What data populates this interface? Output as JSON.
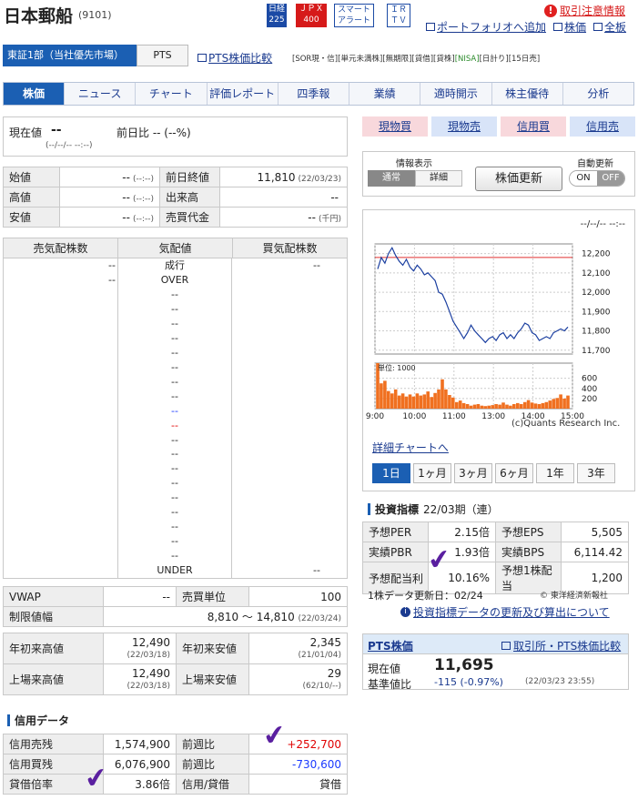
{
  "header": {
    "company_name": "日本郵船",
    "code": "(9101)",
    "badges": [
      {
        "top": "日経",
        "bottom": "225"
      },
      {
        "top": "ＪＰＸ",
        "bottom": "400"
      },
      {
        "top": "スマート",
        "bottom": "アラート"
      },
      {
        "top": "ＩＲ",
        "bottom": "ＴＶ"
      }
    ],
    "alert_link": "取引注意情報",
    "portfolio_link": "ポートフォリオへ追加",
    "stock_price_link": "株価",
    "all_board_link": "全板",
    "market_tabs": [
      "東証1部（当社優先市場）",
      "PTS"
    ],
    "pts_compare_link": "PTS株価比較",
    "tags": [
      "[SOR現・信]",
      "[単元未満株]",
      "[無期限]",
      "[貸借]",
      "[貸株]",
      "[NISA]",
      "[日計り]",
      "[15日売]"
    ]
  },
  "nav": {
    "tabs": [
      "株価",
      "ニュース",
      "チャート",
      "評価レポート",
      "四季報",
      "業績",
      "適時開示",
      "株主優待",
      "分析"
    ]
  },
  "price_box": {
    "current_label": "現在値",
    "current_value": "--",
    "change_text": "前日比 -- (--%)",
    "time_text": "(--/--/-- --:--)"
  },
  "trade_buttons": [
    "現物買",
    "現物売",
    "信用買",
    "信用売"
  ],
  "controls": {
    "info_display_label": "情報表示",
    "normal_label": "通常",
    "detail_label": "詳細",
    "update_button": "株価更新",
    "auto_update_label": "自動更新",
    "on_label": "ON",
    "off_label": "OFF"
  },
  "ohlc": [
    {
      "l1": "始値",
      "v1": "--",
      "t1": "(--:--)",
      "l2": "前日終値",
      "v2": "11,810",
      "t2": "(22/03/23)"
    },
    {
      "l1": "高値",
      "v1": "--",
      "t1": "(--:--)",
      "l2": "出来高",
      "v2": "--",
      "t2": ""
    },
    {
      "l1": "安値",
      "v1": "--",
      "t1": "(--:--)",
      "l2": "売買代金",
      "v2": "--",
      "t2": "(千円)"
    }
  ],
  "board": {
    "headers": [
      "売気配株数",
      "気配値",
      "買気配株数"
    ],
    "rows": [
      {
        "sell": "--",
        "price": "成行",
        "buy": "--"
      },
      {
        "sell": "--",
        "price": "OVER",
        "buy": ""
      },
      {
        "sell": "",
        "price": "--",
        "buy": ""
      },
      {
        "sell": "",
        "price": "--",
        "buy": ""
      },
      {
        "sell": "",
        "price": "--",
        "buy": ""
      },
      {
        "sell": "",
        "price": "--",
        "buy": ""
      },
      {
        "sell": "",
        "price": "--",
        "buy": ""
      },
      {
        "sell": "",
        "price": "--",
        "buy": ""
      },
      {
        "sell": "",
        "price": "--",
        "buy": ""
      },
      {
        "sell": "",
        "price": "--",
        "buy": ""
      },
      {
        "sell": "",
        "price": "--",
        "buy": ""
      },
      {
        "sell": "",
        "price": "--",
        "buy": ""
      },
      {
        "sell": "",
        "price": "--",
        "buy": ""
      },
      {
        "sell": "",
        "price": "--",
        "buy": ""
      },
      {
        "sell": "",
        "price": "--",
        "buy": ""
      },
      {
        "sell": "",
        "price": "--",
        "buy": ""
      },
      {
        "sell": "",
        "price": "--",
        "buy": ""
      },
      {
        "sell": "",
        "price": "--",
        "buy": ""
      },
      {
        "sell": "",
        "price": "--",
        "buy": ""
      },
      {
        "sell": "",
        "price": "--",
        "buy": ""
      },
      {
        "sell": "",
        "price": "--",
        "buy": ""
      },
      {
        "sell": "",
        "price": "UNDER",
        "buy": "--"
      }
    ],
    "blue_row": 10,
    "red_row": 11
  },
  "vwap": {
    "vwap_label": "VWAP",
    "vwap_value": "--",
    "unit_label": "売買単位",
    "unit_value": "100",
    "limit_label": "制限値幅",
    "limit_value": "8,810 〜 14,810",
    "limit_date": "(22/03/24)"
  },
  "yearly": [
    {
      "l1": "年初来高値",
      "v1": "12,490",
      "d1": "(22/03/18)",
      "l2": "年初来安値",
      "v2": "2,345",
      "d2": "(21/01/04)"
    },
    {
      "l1": "上場来高値",
      "v1": "12,490",
      "d1": "(22/03/18)",
      "l2": "上場来安値",
      "v2": "29",
      "d2": "(62/10/--)"
    }
  ],
  "credit": {
    "title": "信用データ",
    "rows": [
      {
        "l1": "信用売残",
        "v1": "1,574,900",
        "l2": "前週比",
        "v2": "+252,700",
        "c2": "red"
      },
      {
        "l1": "信用買残",
        "v1": "6,076,900",
        "l2": "前週比",
        "v2": "-730,600",
        "c2": "blue"
      },
      {
        "l1": "貸借倍率",
        "v1": "3.86倍",
        "l2": "信用/貸借",
        "v2": "貸借",
        "c2": ""
      }
    ]
  },
  "chart": {
    "timestamp": "--/--/-- --:--",
    "volume_label": "単位: 1000",
    "copyright": "(c)Quants Research Inc.",
    "detail_link": "詳細チャートへ",
    "periods": [
      "1日",
      "1ヶ月",
      "3ヶ月",
      "6ヶ月",
      "1年",
      "3年"
    ]
  },
  "chart_data": {
    "type": "line",
    "x_ticks": [
      "9:00",
      "10:00",
      "11:00",
      "13:00",
      "14:00",
      "15:00"
    ],
    "y_ticks": [
      "12,200",
      "12,100",
      "12,000",
      "11,900",
      "11,800",
      "11,700"
    ],
    "ylim": [
      11680,
      12250
    ],
    "volume_ticks": [
      "600",
      "400",
      "200"
    ],
    "volume_ylim": [
      0,
      900
    ],
    "prev_close": 11810,
    "price": [
      12120,
      12180,
      12150,
      12200,
      12230,
      12190,
      12160,
      12140,
      12170,
      12130,
      12110,
      12140,
      12120,
      12090,
      12100,
      12080,
      12060,
      12000,
      11990,
      11950,
      11900,
      11850,
      11820,
      11790,
      11760,
      11790,
      11830,
      11800,
      11780,
      11760,
      11740,
      11760,
      11770,
      11750,
      11780,
      11790,
      11760,
      11780,
      11760,
      11790,
      11810,
      11840,
      11830,
      11790,
      11780,
      11750,
      11760,
      11770,
      11760,
      11790,
      11800,
      11810,
      11800,
      11820
    ],
    "volume": [
      900,
      500,
      550,
      350,
      300,
      380,
      260,
      300,
      240,
      280,
      240,
      300,
      260,
      280,
      340,
      230,
      310,
      380,
      580,
      380,
      270,
      220,
      130,
      160,
      110,
      90,
      60,
      80,
      90,
      60,
      50,
      60,
      70,
      90,
      80,
      120,
      80,
      60,
      90,
      110,
      90,
      130,
      170,
      120,
      100,
      90,
      110,
      130,
      160,
      190,
      210,
      280,
      200,
      260
    ]
  },
  "indicators": {
    "title": "投資指標",
    "period": "22/03期（連）",
    "rows": [
      {
        "l1": "予想PER",
        "v1": "2.15倍",
        "l2": "予想EPS",
        "v2": "5,505"
      },
      {
        "l1": "実績PBR",
        "v1": "1.93倍",
        "l2": "実績BPS",
        "v2": "6,114.42"
      },
      {
        "l1": "予想配当利",
        "v1": "10.16%",
        "l2": "予想1株配当",
        "v2": "1,200"
      }
    ],
    "update_note": "1株データ更新日：02/24",
    "source": "© 東洋経済新報社",
    "notice_link": "投資指標データの更新及び算出について"
  },
  "pts": {
    "title": "PTS株価",
    "compare_link": "取引所・PTS株価比較",
    "current_label": "現在値",
    "current_value": "11,695",
    "base_label": "基準値比",
    "change": "-115 (-0.97%)",
    "time": "(22/03/23 23:55)"
  }
}
